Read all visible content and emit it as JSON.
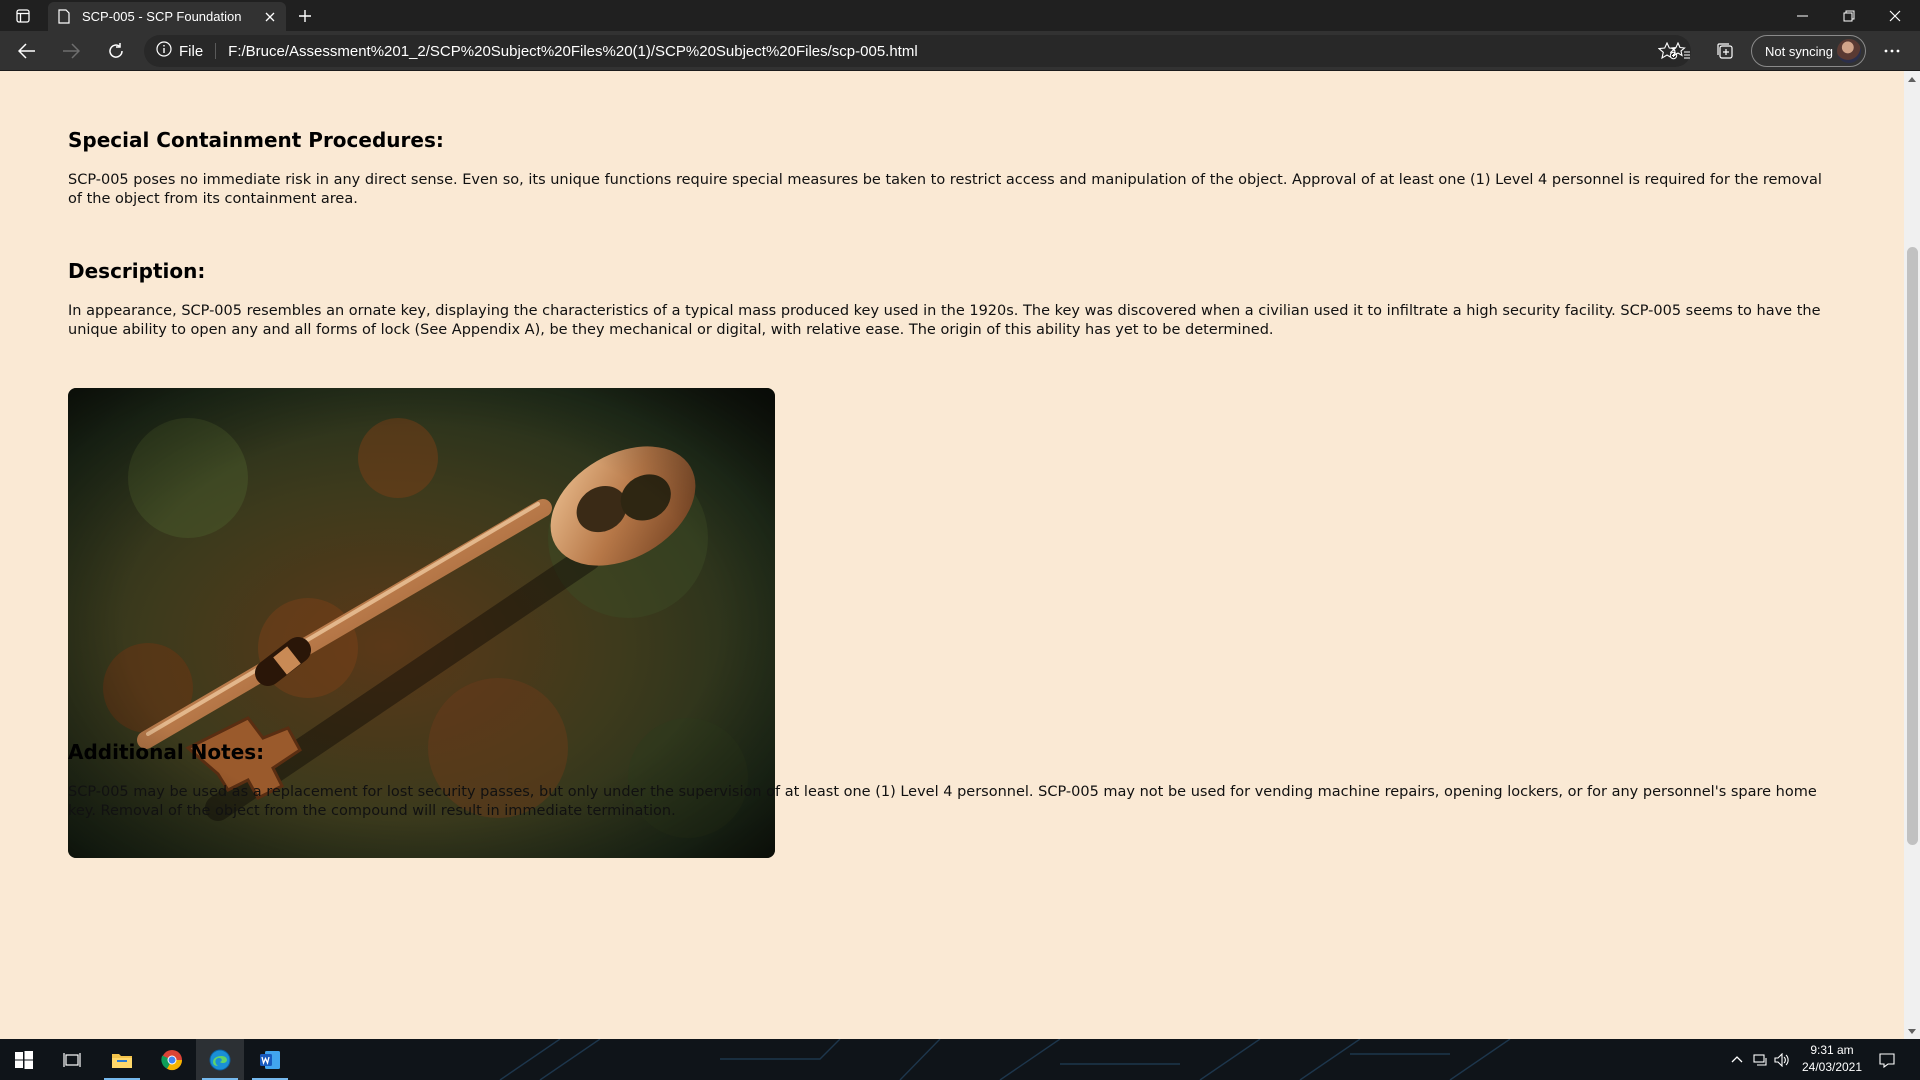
{
  "browser": {
    "tab_title": "SCP-005 - SCP Foundation",
    "site_info_label": "File",
    "url": "F:/Bruce/Assessment%201_2/SCP%20Subject%20Files%20(1)/SCP%20Subject%20Files/scp-005.html",
    "profile_label": "Not syncing"
  },
  "page": {
    "sections": [
      {
        "title": "Special Containment Procedures:",
        "text": "SCP-005 poses no immediate risk in any direct sense. Even so, its unique functions require special measures be taken to restrict access and manipulation of the object. Approval of at least one (1) Level 4 personnel is required for the removal of the object from its containment area."
      },
      {
        "title": "Description:",
        "text": "In appearance, SCP-005 resembles an ornate key, displaying the characteristics of a typical mass produced key used in the 1920s. The key was discovered when a civilian used it to infiltrate a high security facility. SCP-005 seems to have the unique ability to open any and all forms of lock (See Appendix A), be they mechanical or digital, with relative ease. The origin of this ability has yet to be determined."
      },
      {
        "title": "Additional Notes:",
        "text": "SCP-005 may be used as a replacement for lost security passes, but only under the supervision of at least one (1) Level 4 personnel. SCP-005 may not be used for vending machine repairs, opening lockers, or for any personnel's spare home key. Removal of the object from the compound will result in immediate termination."
      }
    ]
  },
  "taskbar": {
    "time": "9:31 am",
    "date": "24/03/2021",
    "apps": [
      "file-explorer",
      "chrome",
      "edge",
      "word"
    ]
  },
  "colors": {
    "page_background": "#fae9d4",
    "browser_chrome": "#202020",
    "toolbar": "#323232"
  }
}
